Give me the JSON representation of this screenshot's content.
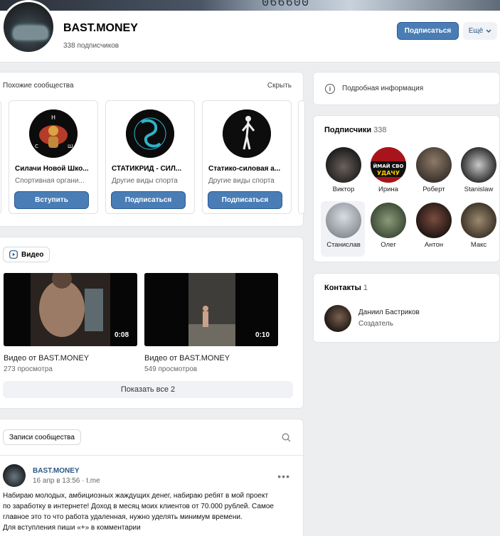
{
  "header": {
    "cover_plate_text": "066600",
    "title": "BAST.MONEY",
    "subscribers": "338 подписчиков",
    "subscribe_label": "Подписаться",
    "more_label": "Ещё"
  },
  "similar": {
    "label": "Похожие сообщества",
    "hide_label": "Скрыть",
    "items": [
      {
        "name": "Силачи Новой Шко...",
        "category": "Спортивная органи...",
        "button": "Вступить"
      },
      {
        "name": "СТАТИКРИД - СИЛ...",
        "category": "Другие виды спорта",
        "button": "Подписаться"
      },
      {
        "name": "Статико-силовая а...",
        "category": "Другие виды спорта",
        "button": "Подписаться"
      }
    ]
  },
  "videos": {
    "tab_label": "Видео",
    "items": [
      {
        "title": "Видео от BAST.MONEY",
        "views": "273 просмотра",
        "duration": "0:08"
      },
      {
        "title": "Видео от BAST.MONEY",
        "views": "549 просмотров",
        "duration": "0:10"
      }
    ],
    "show_all_label": "Показать все 2"
  },
  "posts": {
    "tab_label": "Записи сообщества",
    "post": {
      "author": "BAST.MONEY",
      "meta": "16 апр в 13:56 · t.me",
      "lines": [
        "Набираю молодых, амбициозных жаждущих денег, набираю ребят в мой проект",
        "по заработку в интернете! Доход в месяц моих клиентов от 70.000 рублей. Самое",
        "главное это то что работа удаленная, нужно уделять минимум времени.",
        "Для вступления пиши «+» в комментарии"
      ]
    }
  },
  "info": {
    "label": "Подробная информация"
  },
  "followers": {
    "title": "Подписчики",
    "count": "338",
    "items": [
      {
        "name": "Виктор"
      },
      {
        "name": "Ирина",
        "badge": "ЙМАЙ СВО УДАЧУ"
      },
      {
        "name": "Роберт"
      },
      {
        "name": "Stanislaw"
      },
      {
        "name": "Станислав"
      },
      {
        "name": "Олег"
      },
      {
        "name": "Антон"
      },
      {
        "name": "Макс"
      }
    ]
  },
  "contacts": {
    "title": "Контакты",
    "count": "1",
    "name": "Даниил Бастриков",
    "role": "Создатель"
  },
  "colors": {
    "accent": "#4a7db5",
    "link": "#2a5885",
    "background": "#edeef0"
  }
}
